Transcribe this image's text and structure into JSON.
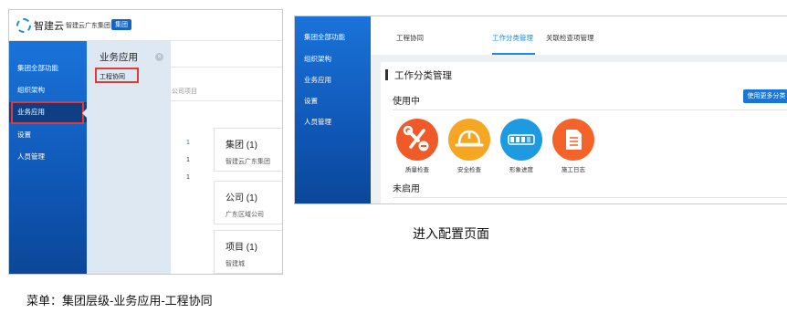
{
  "left_shot": {
    "logo_text": "智建云",
    "org_name": "智建云广东集团",
    "org_badge": "集团",
    "sidebar": [
      {
        "label": "集团全部功能"
      },
      {
        "label": "组织架构"
      },
      {
        "label": "业务应用",
        "active": true
      },
      {
        "label": "设置"
      },
      {
        "label": "人员管理"
      }
    ],
    "flyout": {
      "title": "业务应用",
      "close_glyph": "×",
      "item": "工程协同"
    },
    "content": {
      "crumb": "公司项目",
      "counts": [
        "1",
        "1",
        "1"
      ],
      "cards": [
        {
          "title": "集团 (1)",
          "sub": "智建云广东集团"
        },
        {
          "title": "公司 (1)",
          "sub": "广东区域公司"
        },
        {
          "title": "项目 (1)",
          "sub": "智建城"
        }
      ]
    }
  },
  "right_shot": {
    "sidebar": [
      {
        "label": "集团全部功能"
      },
      {
        "label": "组织架构"
      },
      {
        "label": "业务应用"
      },
      {
        "label": "设置"
      },
      {
        "label": "人员管理"
      }
    ],
    "tabs": {
      "title": "工程协同",
      "active": "工作分类管理",
      "other": "关联检查项管理"
    },
    "section_title": "工作分类管理",
    "in_use_label": "使用中",
    "use_more_button": "使用更多分类",
    "categories": [
      {
        "label": "质量检查",
        "icon": "wrench-icon",
        "color": "#f05a28"
      },
      {
        "label": "安全检查",
        "icon": "hardhat-icon",
        "color": "#f5a623"
      },
      {
        "label": "形象进度",
        "icon": "progress-icon",
        "color": "#1e9be0"
      },
      {
        "label": "施工日志",
        "icon": "document-icon",
        "color": "#f4642a"
      }
    ],
    "unused_label": "未启用"
  },
  "captions": {
    "right": "进入配置页面",
    "left": "菜单：集团层级-业务应用-工程协同"
  },
  "colors": {
    "sidebar_blue": "#1565c0",
    "highlight_red": "#e53935",
    "accent_blue": "#1e88e5"
  }
}
